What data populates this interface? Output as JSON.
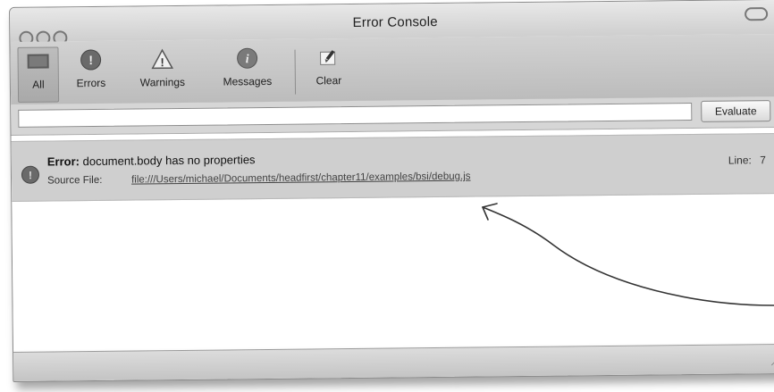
{
  "window": {
    "title": "Error Console"
  },
  "toolbar": {
    "items": [
      {
        "label": "All",
        "icon": "all-icon"
      },
      {
        "label": "Errors",
        "icon": "error-icon"
      },
      {
        "label": "Warnings",
        "icon": "warning-icon"
      },
      {
        "label": "Messages",
        "icon": "message-icon"
      },
      {
        "label": "Clear",
        "icon": "clear-icon"
      }
    ]
  },
  "evaluate": {
    "input_value": "",
    "button_label": "Evaluate"
  },
  "entries": [
    {
      "type": "Error:",
      "message": "document.body has no properties",
      "source_label": "Source File:",
      "source_url": "file:///Users/michael/Documents/headfirst/chapter11/examples/bsi/debug.js",
      "line_label": "Line:",
      "line": "7"
    }
  ],
  "colors": {
    "toolbar": "#c8c8c8",
    "error_row": "#cfcfcf",
    "error_icon": "#6a6a6a"
  }
}
